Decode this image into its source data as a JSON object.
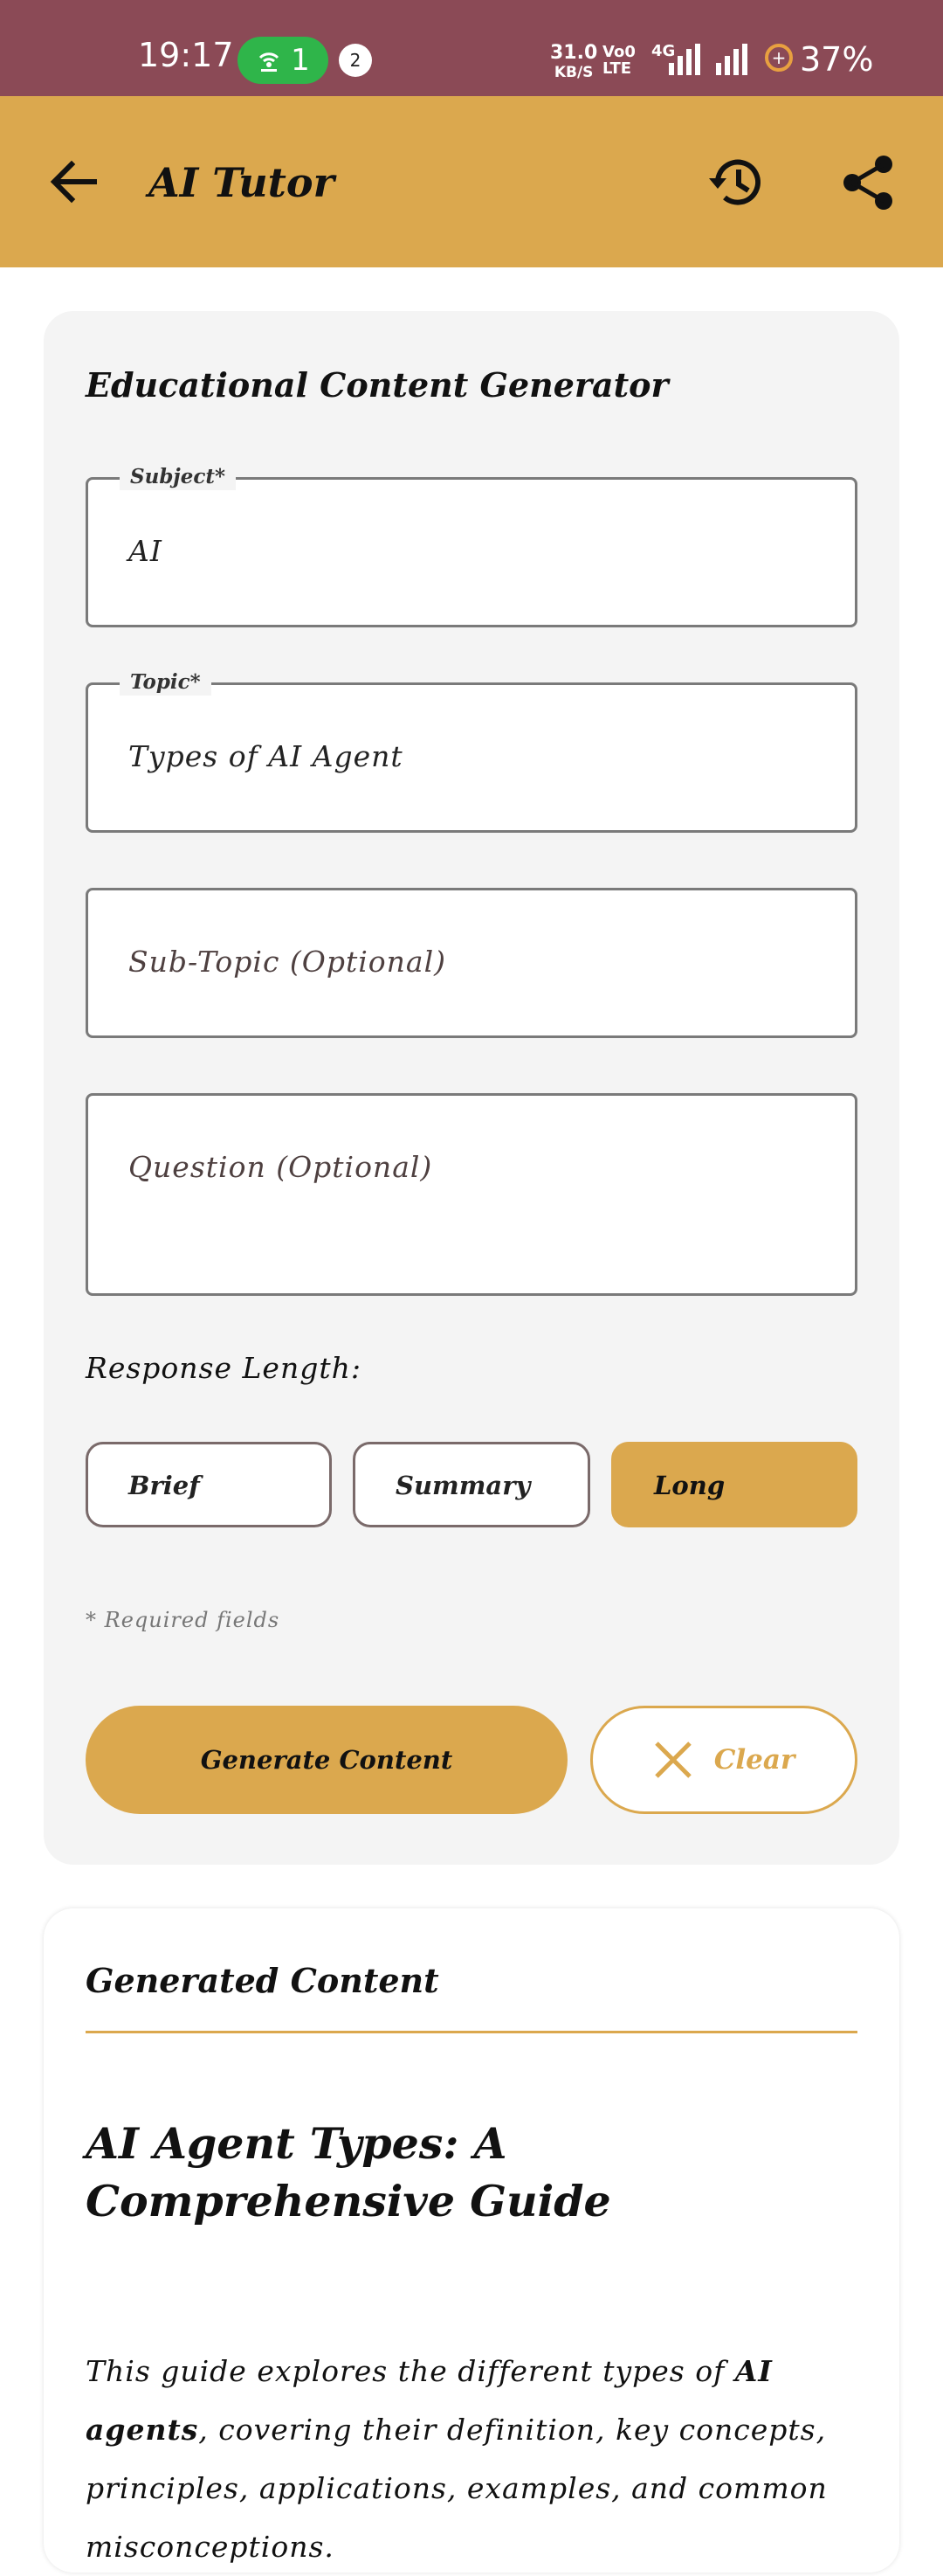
{
  "status_bar": {
    "time": "19:17",
    "hotspot_count": "1",
    "notification_count": "2",
    "net_speed": "31.0",
    "net_speed_unit": "KB/S",
    "volte": "Vo0 LTE",
    "network": "4G",
    "battery": "37%"
  },
  "appbar": {
    "title": "AI Tutor",
    "back_icon": "arrow-left-icon",
    "history_icon": "history-icon",
    "share_icon": "share-icon"
  },
  "form": {
    "title": "Educational Content Generator",
    "subject": {
      "label": "Subject*",
      "value": "AI"
    },
    "topic": {
      "label": "Topic*",
      "value": "Types of AI Agent"
    },
    "subtopic": {
      "placeholder": "Sub-Topic (Optional)"
    },
    "question": {
      "placeholder": "Question (Optional)"
    },
    "response_length_label": "Response Length:",
    "length_options": [
      "Brief",
      "Summary",
      "Long"
    ],
    "selected_length": "Long",
    "required_note": "* Required fields",
    "generate_label": "Generate Content",
    "clear_label": "Clear"
  },
  "output": {
    "title": "Generated Content",
    "doc_title": "AI Agent Types: A Comprehensive Guide",
    "intro_before": "This guide explores the different types of ",
    "intro_bold": "AI agents",
    "intro_after": ", covering their definition, key concepts, principles, applications, examples, and common misconceptions."
  },
  "colors": {
    "status_bar": "#8b4a56",
    "accent": "#dba84e",
    "card_bg": "#f4f4f4"
  }
}
